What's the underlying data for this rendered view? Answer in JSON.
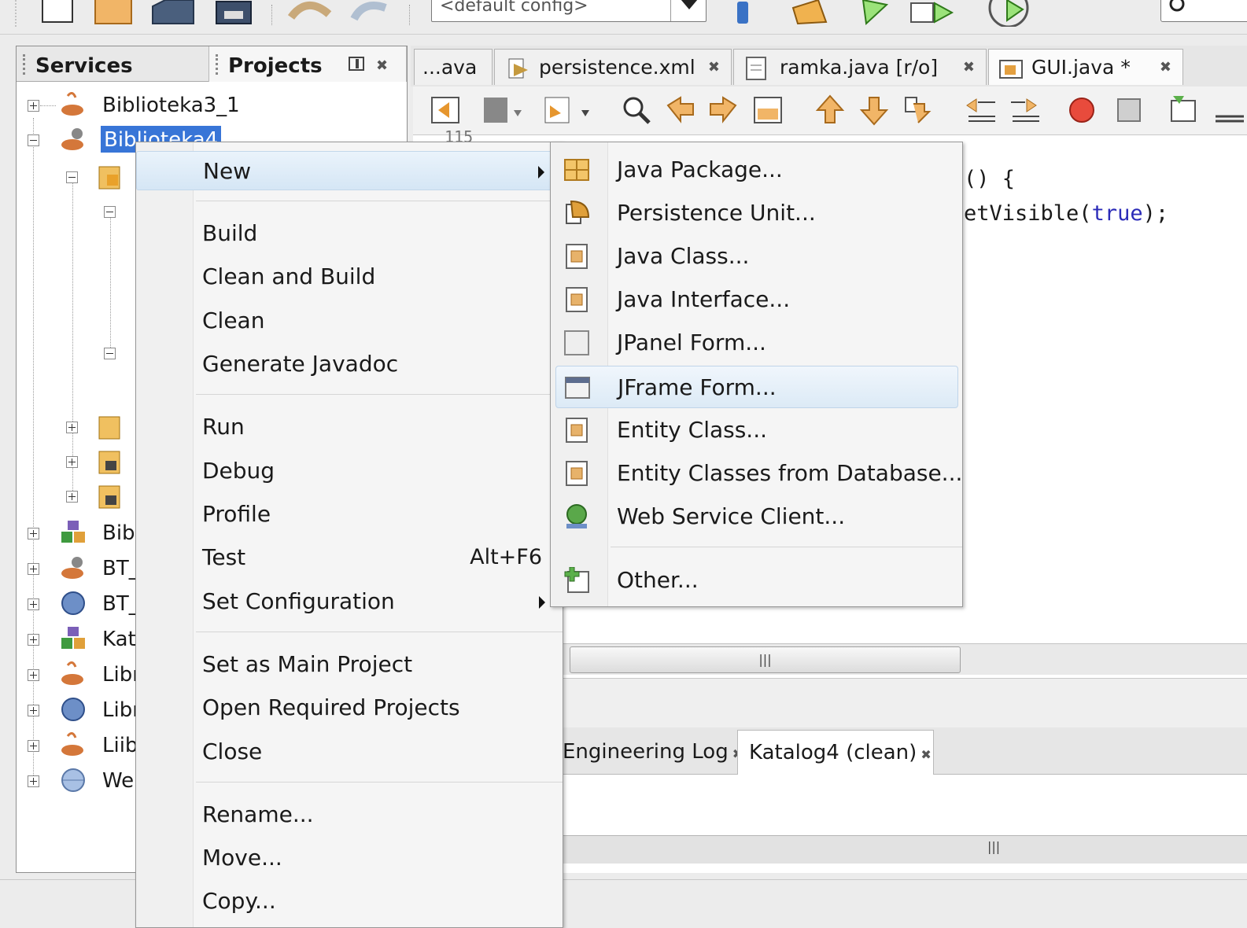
{
  "toolbar": {
    "config_value": "<default config>"
  },
  "left_panel": {
    "tabs": [
      "Services",
      "Projects"
    ],
    "tree": [
      {
        "label": "Biblioteka3_1"
      },
      {
        "label": "Biblioteka4"
      },
      {
        "label": "Bibl"
      },
      {
        "label": "BT_"
      },
      {
        "label": "BT_"
      },
      {
        "label": "Kat"
      },
      {
        "label": "Libr"
      },
      {
        "label": "Libr"
      },
      {
        "label": "Liib"
      },
      {
        "label": "We"
      }
    ]
  },
  "editor": {
    "tabs": [
      {
        "label": "...ava"
      },
      {
        "label": "persistence.xml"
      },
      {
        "label": "ramka.java [r/o]"
      },
      {
        "label": "GUI.java *"
      }
    ],
    "code_lines": [
      "() {",
      "etVisible(true);"
    ],
    "line_number_fragment": "115"
  },
  "output": {
    "tabs": [
      {
        "label": "Engineering Log"
      },
      {
        "label": "Katalog4 (clean)"
      }
    ]
  },
  "context_menu": {
    "items": [
      {
        "label": "New"
      },
      {
        "label": "Build"
      },
      {
        "label": "Clean and Build"
      },
      {
        "label": "Clean"
      },
      {
        "label": "Generate Javadoc"
      },
      {
        "label": "Run"
      },
      {
        "label": "Debug"
      },
      {
        "label": "Profile"
      },
      {
        "label": "Test",
        "shortcut": "Alt+F6"
      },
      {
        "label": "Set Configuration"
      },
      {
        "label": "Set as Main Project"
      },
      {
        "label": "Open Required Projects"
      },
      {
        "label": "Close"
      },
      {
        "label": "Rename..."
      },
      {
        "label": "Move..."
      },
      {
        "label": "Copy..."
      }
    ]
  },
  "submenu": {
    "items": [
      {
        "label": "Java Package...",
        "icon": "package-icon"
      },
      {
        "label": "Persistence Unit...",
        "icon": "persistence-unit-icon"
      },
      {
        "label": "Java Class...",
        "icon": "java-class-icon"
      },
      {
        "label": "Java Interface...",
        "icon": "java-interface-icon"
      },
      {
        "label": "JPanel Form...",
        "icon": "jpanel-icon"
      },
      {
        "label": "JFrame Form...",
        "icon": "jframe-icon"
      },
      {
        "label": "Entity Class...",
        "icon": "entity-class-icon"
      },
      {
        "label": "Entity Classes from Database...",
        "icon": "entity-db-icon"
      },
      {
        "label": "Web Service Client...",
        "icon": "web-service-icon"
      },
      {
        "label": "Other...",
        "icon": "other-icon"
      }
    ]
  },
  "colors": {
    "selection": "#3875d7",
    "menu_highlight": "#d5e6f5",
    "code_keyword": "#2b2bb8"
  }
}
